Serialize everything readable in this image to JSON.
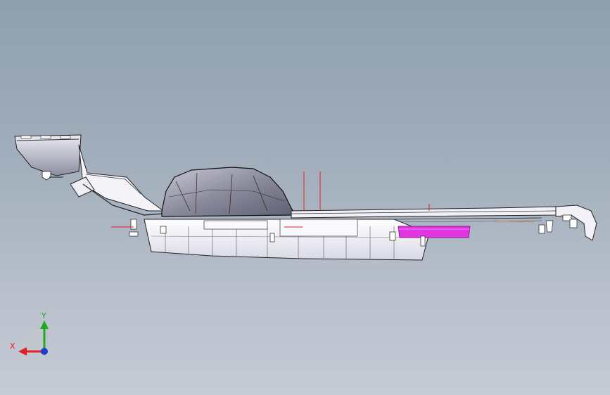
{
  "viewport": {
    "background_top": "#8e9fae",
    "background_bottom": "#c6cbd6"
  },
  "triad": {
    "x_label": "X",
    "y_label": "Y",
    "x_color": "#e02020",
    "y_color": "#1faa1f",
    "z_color": "#1a3fd0"
  },
  "model": {
    "highlight_color": "#e236e2",
    "datum_line_color": "#e02020"
  }
}
